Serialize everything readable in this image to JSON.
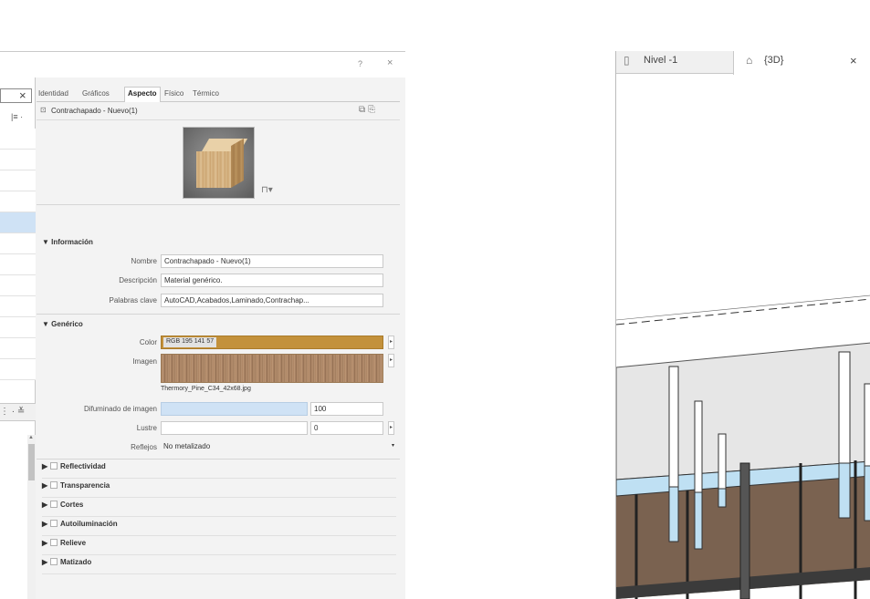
{
  "dialog": {
    "help_label": "?",
    "close_label": "×"
  },
  "library": {
    "search_clear": "×",
    "view_button": "|≡ ·",
    "splitter_icon": "⋮ · ≚"
  },
  "editor": {
    "tabs": [
      {
        "label": "Identidad"
      },
      {
        "label": "Gráficos"
      },
      {
        "label": "Aspecto"
      },
      {
        "label": "Físico"
      },
      {
        "label": "Térmico"
      }
    ],
    "asset_name": "Contrachapado - Nuevo(1)",
    "info_section": "▼ Información",
    "nombre_label": "Nombre",
    "nombre_value": "Contrachapado - Nuevo(1)",
    "descripcion_label": "Descripción",
    "descripcion_value": "Material genérico.",
    "palabras_label": "Palabras clave",
    "palabras_value": "AutoCAD,Acabados,Laminado,Contrachap...",
    "generico_section": "▼ Genérico",
    "color_label": "Color",
    "color_value": "RGB 195 141 57",
    "color_hex": "#c38d39",
    "imagen_label": "Imagen",
    "imagen_file": "Thermory_Pine_C34_42x68.jpg",
    "difuminado_label": "Difuminado de imagen",
    "difuminado_value": "100",
    "lustre_label": "Lustre",
    "lustre_value": "0",
    "reflejos_label": "Reflejos",
    "reflejos_value": "No metalizado",
    "sections": [
      {
        "label": "Reflectividad"
      },
      {
        "label": "Transparencia"
      },
      {
        "label": "Cortes"
      },
      {
        "label": "Autoiluminación"
      },
      {
        "label": "Relieve"
      },
      {
        "label": "Matizado"
      }
    ]
  },
  "view3d": {
    "tab_nivel": "Nivel -1",
    "tab_3d": "{3D}",
    "close_label": "×"
  }
}
